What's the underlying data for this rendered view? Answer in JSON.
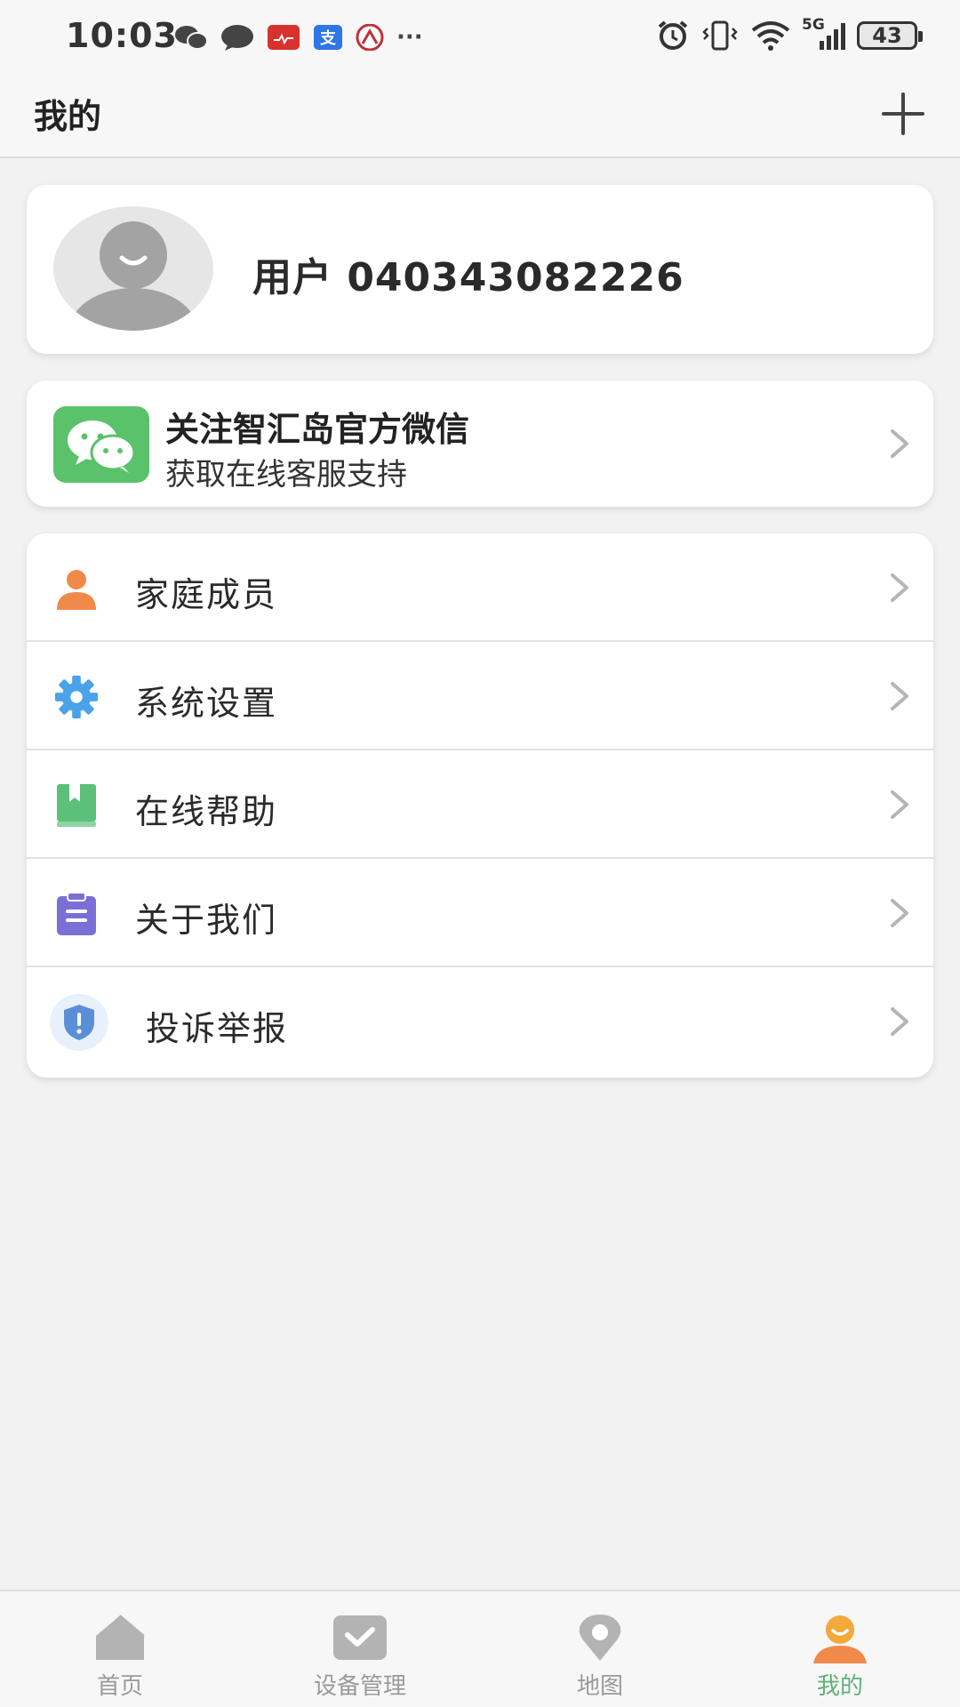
{
  "status_bar": {
    "time": "10:03",
    "network": "5G",
    "battery": "43",
    "more": "···"
  },
  "header": {
    "title": "我的"
  },
  "profile": {
    "username": "用户 040343082226"
  },
  "wechat_banner": {
    "title": "关注智汇岛官方微信",
    "subtitle": "获取在线客服支持"
  },
  "menu": {
    "items": [
      {
        "label": "家庭成员",
        "icon": "person-icon",
        "color": "#f08a4b"
      },
      {
        "label": "系统设置",
        "icon": "gear-icon",
        "color": "#4aa3e8"
      },
      {
        "label": "在线帮助",
        "icon": "book-icon",
        "color": "#5cbf7a"
      },
      {
        "label": "关于我们",
        "icon": "clipboard-icon",
        "color": "#7b6fd6"
      },
      {
        "label": "投诉举报",
        "icon": "shield-alert-icon",
        "color": "#5a8fd8"
      }
    ]
  },
  "tabbar": {
    "tabs": [
      {
        "label": "首页",
        "icon": "home-icon"
      },
      {
        "label": "设备管理",
        "icon": "check-box-icon"
      },
      {
        "label": "地图",
        "icon": "map-pin-icon"
      },
      {
        "label": "我的",
        "icon": "user-icon",
        "active": true
      }
    ]
  },
  "colors": {
    "accent_active": "#5fb07a",
    "wechat_green": "#5ac26a",
    "tab_inactive": "#9a9a9a"
  }
}
